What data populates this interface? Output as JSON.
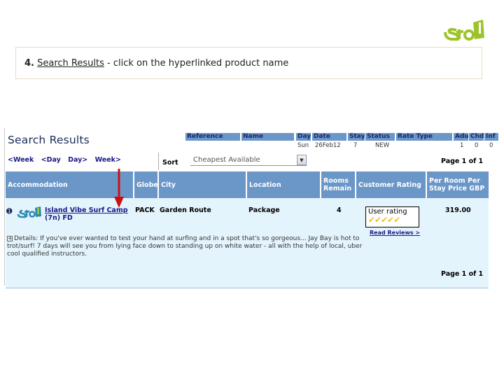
{
  "brand": {
    "logo_icon": "sta-logo-icon",
    "accent": "#9cc42a"
  },
  "instruction": {
    "step": "4.",
    "link_text": "Search Results",
    "text": " - click on the hyperlinked product name"
  },
  "search": {
    "title": "Search Results",
    "nav": [
      "<Week",
      "<Day",
      "Day>",
      "Week>"
    ],
    "sort_label": "Sort",
    "sort_value": "Cheapest Available",
    "page_top": "Page 1 of 1",
    "page_bottom": "Page 1 of 1"
  },
  "reference": {
    "headers": [
      "Reference",
      "Name",
      "Day",
      "Date",
      "Stay",
      "Status",
      "Rate Type",
      "Adu",
      "Chd",
      "Inf"
    ],
    "values": {
      "day": "Sun",
      "date": "26Feb12",
      "stay": "7",
      "status": "NEW",
      "adu": "1",
      "chd": "0",
      "inf": "0"
    }
  },
  "results": {
    "columns": [
      "Accommodation",
      "Globe",
      "City",
      "Location",
      "Rooms Remain",
      "Customer Rating",
      "Per Room Per Stay Price GBP"
    ],
    "rows": [
      {
        "info_icon": "info-icon",
        "name": "Island Vibe Surf Camp",
        "name_sub": "(7n) FD",
        "globe": "PACK",
        "city": "Garden Route",
        "location": "Package",
        "rooms_remain": "4",
        "rating_label": "User rating",
        "rating": 5,
        "rating_max": 5,
        "reviews_link": "Read Reviews >",
        "price": "319.00",
        "details": "Details: If you've ever wanted to test your hand at surfing and in a spot that's so gorgeous... Jay Bay is hot to trot/surf! 7 days will see you from lying face down to standing up on white water - all with the help of local, uber cool qualified instructors."
      }
    ]
  },
  "annotation": {
    "arrow_color": "#cc1010"
  }
}
